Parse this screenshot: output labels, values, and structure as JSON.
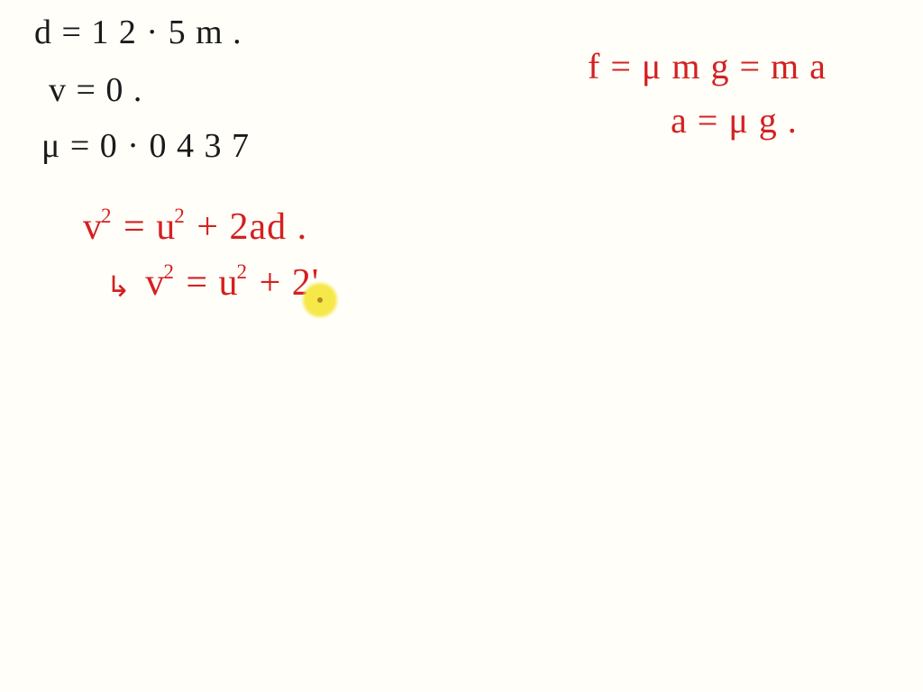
{
  "given": {
    "d": "d = 1 2 · 5 m .",
    "v": "v = 0  .",
    "mu": "μ =   0 · 0 4 3 7"
  },
  "force": {
    "eq1": "f = μ m g = m a",
    "eq2": "a = μ g ."
  },
  "kinematics": {
    "eq1_pre": "v",
    "eq1_mid": "= u",
    "eq1_post": "+ 2ad .",
    "eq2_arrow": "↳",
    "eq2_pre": "v",
    "eq2_mid": "= u",
    "eq2_post": "+  2",
    "eq2_tail": "'",
    "exp": "2"
  }
}
